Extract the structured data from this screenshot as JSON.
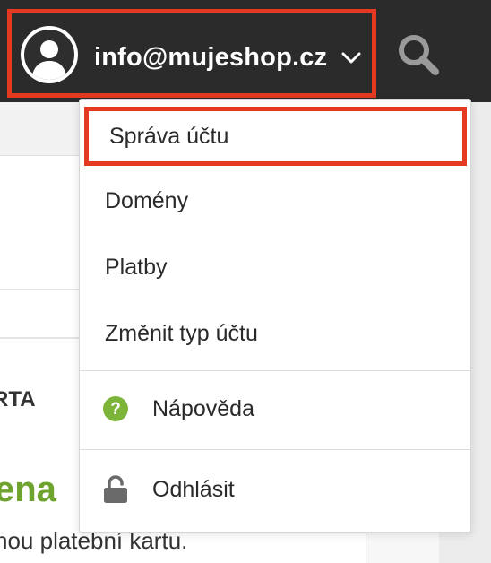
{
  "header": {
    "account_email": "info@mujeshop.cz",
    "avatar_icon": "user-avatar-icon",
    "chevron_icon": "chevron-down-icon",
    "search_icon": "search-icon"
  },
  "account_menu": {
    "items": [
      {
        "label": "Správa účtu",
        "highlighted": true
      },
      {
        "label": "Domény"
      },
      {
        "label": "Platby"
      },
      {
        "label": "Změnit typ účtu"
      }
    ],
    "help": {
      "label": "Nápověda",
      "icon": "help-icon"
    },
    "logout": {
      "label": "Odhlásit",
      "icon": "unlock-icon"
    }
  },
  "background_page": {
    "heading_fragment": "RTA",
    "price_fragment": "ena",
    "text_fragment": "nou platební kartu."
  },
  "colors": {
    "topbar": "#2b2b2b",
    "highlight_border": "#e43a22",
    "help_icon": "#7db53a",
    "price_text": "#6ea32e"
  }
}
